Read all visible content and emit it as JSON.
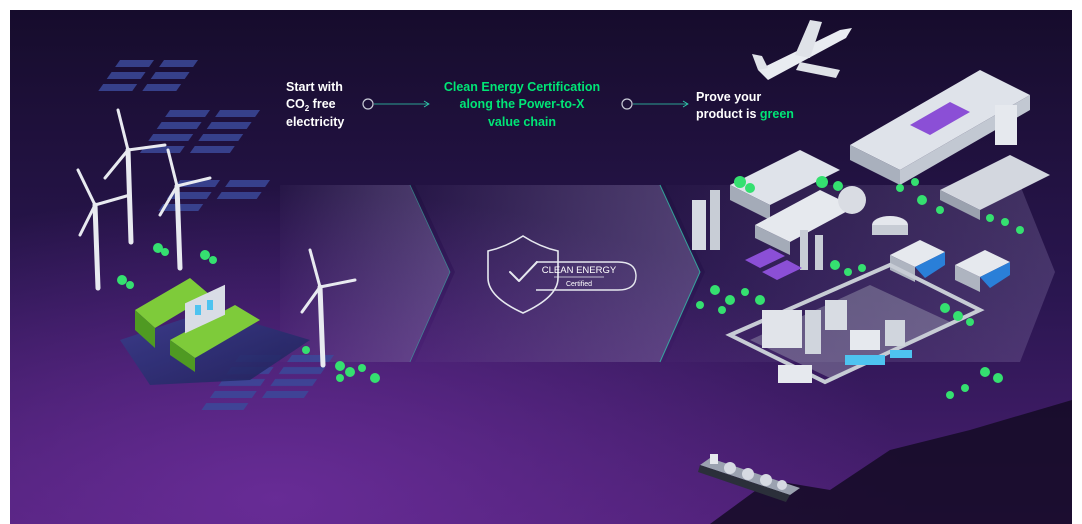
{
  "steps": {
    "start_line1": "Start with",
    "start_co": "CO",
    "start_sub": "2",
    "start_free": " free",
    "start_line3": "electricity",
    "cert_line1": "Clean Energy Certification",
    "cert_line2": "along the Power-to-X",
    "cert_line3": "value chain",
    "prove_line1": "Prove your",
    "prove_line2a": "product is ",
    "prove_line2b": "green"
  },
  "badge": {
    "title": "CLEAN ENERGY",
    "subtitle": "Certified"
  },
  "colors": {
    "background_dark": "#1a0f33",
    "background_purple": "#5b2a86",
    "accent_green": "#00e676",
    "text_white": "#ffffff",
    "chevron_fill": "#6a5a8c"
  }
}
